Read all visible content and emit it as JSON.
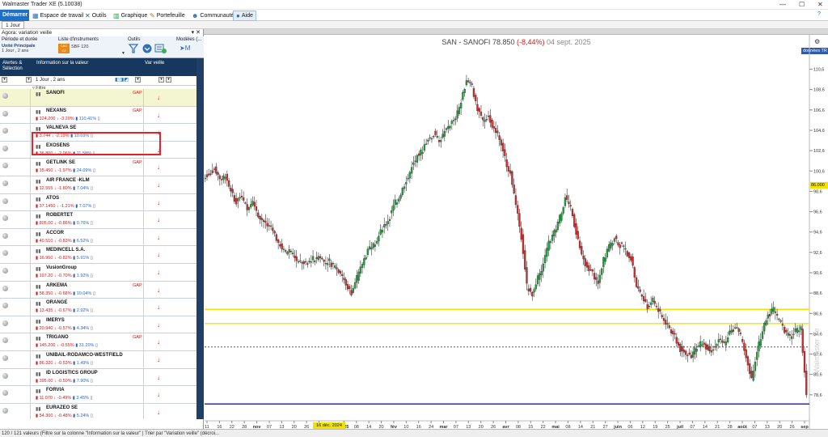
{
  "window": {
    "title": "Walmaster Trader XE  (5.10038)",
    "min": "—",
    "max": "☐",
    "close": "✕",
    "help": "?"
  },
  "menu": {
    "start": "Démarrer",
    "items": [
      {
        "label": "Espace de travail",
        "icon": "▦"
      },
      {
        "label": "Outils",
        "icon": "✕"
      },
      {
        "label": "Graphique",
        "icon": "▥"
      },
      {
        "label": "Portefeuille",
        "icon": "✎"
      },
      {
        "label": "Communauté",
        "icon": "☻"
      },
      {
        "label": "Aide",
        "icon": "●"
      }
    ]
  },
  "tabs": {
    "first": "1 Jour"
  },
  "left": {
    "panel_title": "Agora: variation veille",
    "config": {
      "periode_label": "Période et durée",
      "periode_value": "Unité Principale",
      "periode_value2": "1 Jour , 2 ans",
      "liste_label": "Liste d'instruments",
      "liste_value": "SBF 120",
      "liste_codes": "-CAC\n-OJ",
      "outils_label": "Outils",
      "modeles_label": "Modèles (..."
    },
    "columns": {
      "c1": "Alertes & Sélection",
      "c2": "Information sur la valeur",
      "c3": "Var veille"
    },
    "filter_value": "1 Jour , 2 ans",
    "filter_label": "Filtre",
    "rows": [
      {
        "name": "SANOFI",
        "price": "",
        "chg": "",
        "pct": "",
        "gap": "GAP"
      },
      {
        "name": "NEXANS",
        "price": "124.200",
        "chg": "-3.20%",
        "pct": "110.41%",
        "gap": "GAP"
      },
      {
        "name": "VALNEVA SE",
        "price": "3.744",
        "chg": "-2.19%",
        "pct": "10.69%",
        "gap": ""
      },
      {
        "name": "EXOSENS",
        "price": "36.800",
        "chg": "-2.06%",
        "pct": "11.58%",
        "gap": ""
      },
      {
        "name": "GETLINK SE",
        "price": "15.450",
        "chg": "-1.97%",
        "pct": "24.09%",
        "gap": "GAP"
      },
      {
        "name": "AIR FRANCE -KLM",
        "price": "12.555",
        "chg": "-1.80%",
        "pct": "7.04%",
        "gap": ""
      },
      {
        "name": "ATOS",
        "price": "37.1450",
        "chg": "-1.21%",
        "pct": "7.07%",
        "gap": ""
      },
      {
        "name": "ROBERTET",
        "price": "805.00",
        "chg": "-0.86%",
        "pct": "0.76%",
        "gap": ""
      },
      {
        "name": "ACCOR",
        "price": "40.510",
        "chg": "-0.83%",
        "pct": "6.52%",
        "gap": ""
      },
      {
        "name": "MEDINCELL S.A.",
        "price": "16.960",
        "chg": "-0.82%",
        "pct": "5.91%",
        "gap": ""
      },
      {
        "name": "VusionGroup",
        "price": "197.20",
        "chg": "-0.70%",
        "pct": "1.92%",
        "gap": ""
      },
      {
        "name": "ARKEMA",
        "price": "58.350",
        "chg": "-0.68%",
        "pct": "10.04%",
        "gap": "GAP"
      },
      {
        "name": "ORANGE",
        "price": "13.435",
        "chg": "-0.67%",
        "pct": "2.92%",
        "gap": ""
      },
      {
        "name": "IMERYS",
        "price": "20.940",
        "chg": "-0.57%",
        "pct": "4.34%",
        "gap": ""
      },
      {
        "name": "TRIGANO",
        "price": "145.200",
        "chg": "-0.55%",
        "pct": "31.20%",
        "gap": "GAP"
      },
      {
        "name": "UNIBAIL-RODAMCO-WESTFIELD",
        "price": "86.320",
        "chg": "-0.53%",
        "pct": "1.49%",
        "gap": ""
      },
      {
        "name": "ID LOGISTICS GROUP",
        "price": "395.00",
        "chg": "-0.50%",
        "pct": "7.90%",
        "gap": ""
      },
      {
        "name": "FORVIA",
        "price": "11.070",
        "chg": "-0.49%",
        "pct": "3.45%",
        "gap": ""
      },
      {
        "name": "EURAZEO SE",
        "price": "54.300",
        "chg": "-0.48%",
        "pct": "5.24%",
        "gap": ""
      }
    ]
  },
  "status": "120 / 121 valeurs (Filtre sur la colonne \"Information sur la valeur\" | Trier par \"Variation veille\" (décroi...",
  "chart": {
    "symbol": "SAN - SANOFI",
    "price": "78.850",
    "change": "(-8,44%)",
    "date": "04 sept. 2025",
    "last_price": "86.000",
    "donnees_label": "données TR",
    "watermark": "Walmaster Ve",
    "highlight_date": "16 déc. 2024",
    "colors": {
      "up": "#1e9e3a",
      "down": "#d12a2a",
      "hline_yellow": "#f0e400",
      "hline_blue": "#1a1aa8",
      "hline_dashed": "#555555"
    }
  },
  "chart_data": {
    "type": "candlestick",
    "title": "SAN - SANOFI 78.850 (-8,44%) 04 sept. 2025",
    "y_ticks": [
      "110,6",
      "108,6",
      "106,6",
      "104,6",
      "102,6",
      "100,6",
      "98,6",
      "96,6",
      "94,6",
      "92,6",
      "90,6",
      "88,6",
      "86,6",
      "84,6",
      "82,6",
      "80,6",
      "78,6"
    ],
    "ylim": [
      76.6,
      111.6
    ],
    "x_ticks": [
      "11",
      "16",
      "22",
      "28",
      "nov",
      "07",
      "13",
      "20",
      "26",
      "déc",
      "16 déc. 2024",
      "2025",
      "08",
      "14",
      "20",
      "fév",
      "10",
      "16",
      "24",
      "mar",
      "07",
      "13",
      "20",
      "26",
      "avr",
      "08",
      "15",
      "22",
      "mai",
      "08",
      "14",
      "21",
      "27",
      "juin",
      "06",
      "12",
      "19",
      "25",
      "juil",
      "07",
      "14",
      "21",
      "28",
      "août",
      "07",
      "13",
      "20",
      "26",
      "sep"
    ],
    "hlines": [
      {
        "value": 87.0,
        "color": "yellow"
      },
      {
        "value": 85.6,
        "color": "yellow"
      },
      {
        "value": 83.3,
        "color": "dashed"
      },
      {
        "value": 77.7,
        "color": "blue"
      }
    ],
    "close_path": [
      100.3,
      100.8,
      99.9,
      100.2,
      98.5,
      97.4,
      98.2,
      97.0,
      97.8,
      96.0,
      95.6,
      95.0,
      94.3,
      93.2,
      92.5,
      92.9,
      91.9,
      91.6,
      91.4,
      92.0,
      92.2,
      91.7,
      91.8,
      91.2,
      90.7,
      89.5,
      88.6,
      90.2,
      91.5,
      92.7,
      93.4,
      94.2,
      95.3,
      96.1,
      97.6,
      98.4,
      99.7,
      100.9,
      101.9,
      102.6,
      103.8,
      104.1,
      103.5,
      104.4,
      105.1,
      105.8,
      107.3,
      109.6,
      109.0,
      106.4,
      105.6,
      106.2,
      104.7,
      103.8,
      101.9,
      100.3,
      97.2,
      94.1,
      89.4,
      88.5,
      90.1,
      91.5,
      93.6,
      94.6,
      96.1,
      97.8,
      96.9,
      94.5,
      92.3,
      91.1,
      90.6,
      89.5,
      91.9,
      93.2,
      93.9,
      93.2,
      92.9,
      92.0,
      89.1,
      88.3,
      87.1,
      88.0,
      86.8,
      85.8,
      85.2,
      84.4,
      83.0,
      82.7,
      82.4,
      83.3,
      83.7,
      83.1,
      82.9,
      84.0,
      83.6,
      84.9,
      85.1,
      84.5,
      82.3,
      80.1,
      82.9,
      84.7,
      86.6,
      87.0,
      85.9,
      84.9,
      84.3,
      84.9,
      85.2,
      78.8
    ]
  }
}
